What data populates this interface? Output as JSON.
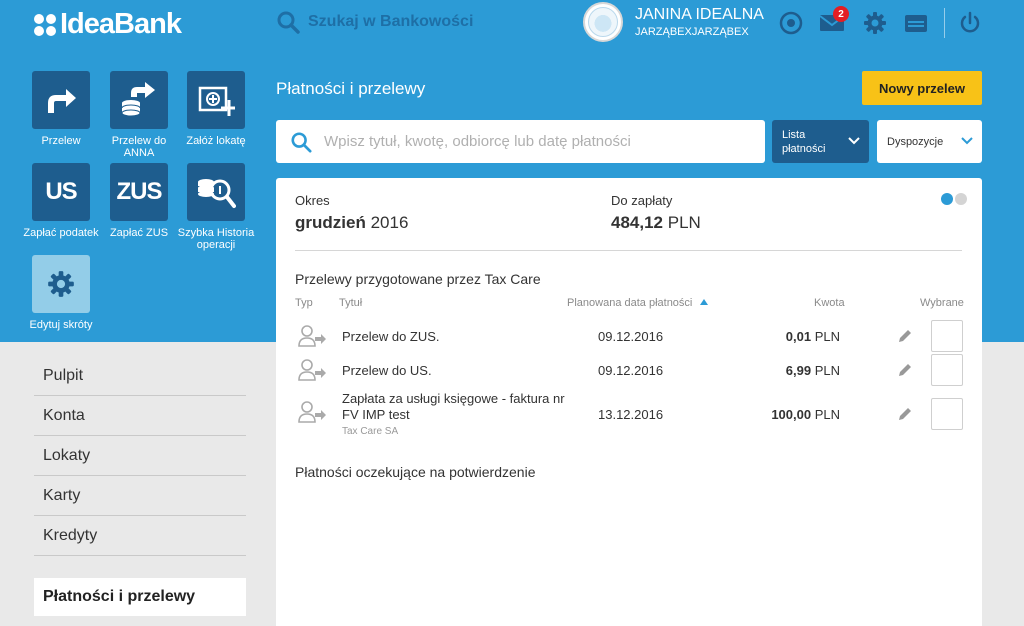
{
  "header": {
    "logo_text": "IdeaBank",
    "search_label": "Szukaj w Bankowości",
    "user_name": "JANINA IDEALNA",
    "user_sub": "JARZĄBEXJARZĄBEX",
    "messages_badge": "2",
    "icons": [
      "target-icon",
      "mail-icon",
      "gear-icon",
      "drawer-icon",
      "power-icon"
    ]
  },
  "shortcuts": [
    {
      "label": "Przelew",
      "icon": "transfer-icon"
    },
    {
      "label": "Przelew do ANNA WARDEDWARD",
      "icon": "transfer-coins-icon"
    },
    {
      "label": "Załóż lokatę",
      "icon": "deposit-icon"
    },
    {
      "label": "Zapłać podatek",
      "icon_text": "US"
    },
    {
      "label": "Zapłać ZUS",
      "icon_text": "ZUS"
    },
    {
      "label": "Szybka Historia operacji",
      "icon": "coins-search-icon"
    },
    {
      "label": "Edytuj skróty",
      "icon": "gear-icon"
    }
  ],
  "nav": {
    "items": [
      "Pulpit",
      "Konta",
      "Lokaty",
      "Karty",
      "Kredyty"
    ],
    "active": "Płatności i przelewy"
  },
  "main": {
    "title": "Płatności i przelewy",
    "new_transfer_button": "Nowy przelew",
    "search_placeholder": "Wpisz tytuł, kwotę, odbiorcę lub datę płatności",
    "list_dropdown": "Lista płatności",
    "dispositions_dropdown": "Dyspozycje",
    "period_label": "Okres",
    "period_month": "grudzień",
    "period_year": "2016",
    "due_label": "Do zapłaty",
    "due_amount": "484,12",
    "due_currency": "PLN",
    "section1_title": "Przelewy przygotowane przez Tax Care",
    "columns": {
      "type": "Typ",
      "title": "Tytuł",
      "date": "Planowana data płatności",
      "amount": "Kwota",
      "selected": "Wybrane"
    },
    "rows": [
      {
        "title": "Przelew do ZUS.",
        "subtitle": "",
        "date": "09.12.2016",
        "amount": "0,01",
        "currency": "PLN"
      },
      {
        "title": "Przelew do US.",
        "subtitle": "",
        "date": "09.12.2016",
        "amount": "6,99",
        "currency": "PLN"
      },
      {
        "title": "Zapłata za usługi księgowe - faktura nr FV IMP test",
        "subtitle": "Tax Care SA",
        "date": "13.12.2016",
        "amount": "100,00",
        "currency": "PLN"
      }
    ],
    "section2_title": "Płatności oczekujące na potwierdzenie"
  },
  "colors": {
    "primary_blue": "#2c9bd6",
    "dark_blue": "#1e5d8e",
    "accent_yellow": "#f8c217",
    "badge_red": "#e31e24"
  }
}
